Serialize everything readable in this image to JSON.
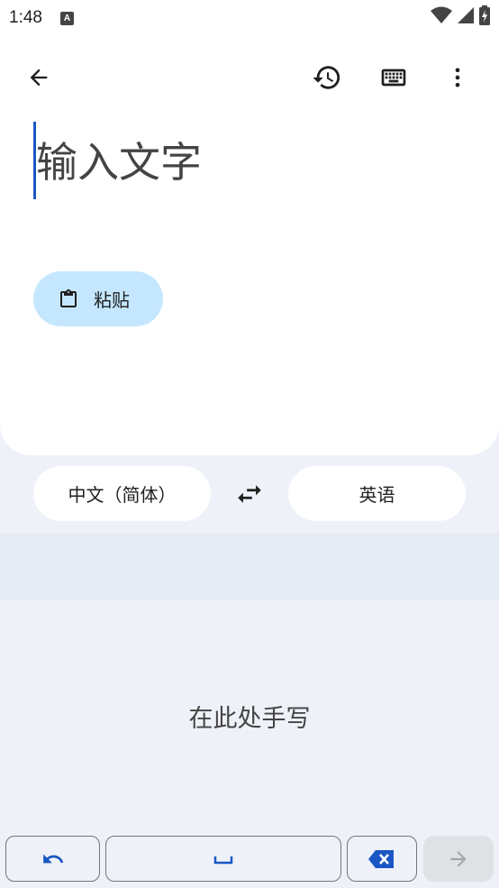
{
  "status_bar": {
    "time": "1:48",
    "app_icon_letter": "A"
  },
  "toolbar": {
    "back_icon": "arrow-back-icon",
    "history_icon": "history-icon",
    "keyboard_icon": "keyboard-icon",
    "more_icon": "more-vert-icon"
  },
  "input": {
    "placeholder": "输入文字",
    "value": ""
  },
  "paste": {
    "label": "粘贴",
    "icon": "clipboard-icon"
  },
  "languages": {
    "source": "中文（简体）",
    "target": "英语",
    "swap_icon": "swap-icon"
  },
  "handwriting": {
    "hint": "在此处手写"
  },
  "keys": {
    "undo_icon": "undo-icon",
    "space_icon": "space-icon",
    "backspace_icon": "backspace-icon",
    "next_icon": "arrow-forward-icon"
  },
  "colors": {
    "accent_blue": "#1a57c4",
    "paste_bg": "#c4e7ff",
    "page_bg": "#eef1f8"
  }
}
